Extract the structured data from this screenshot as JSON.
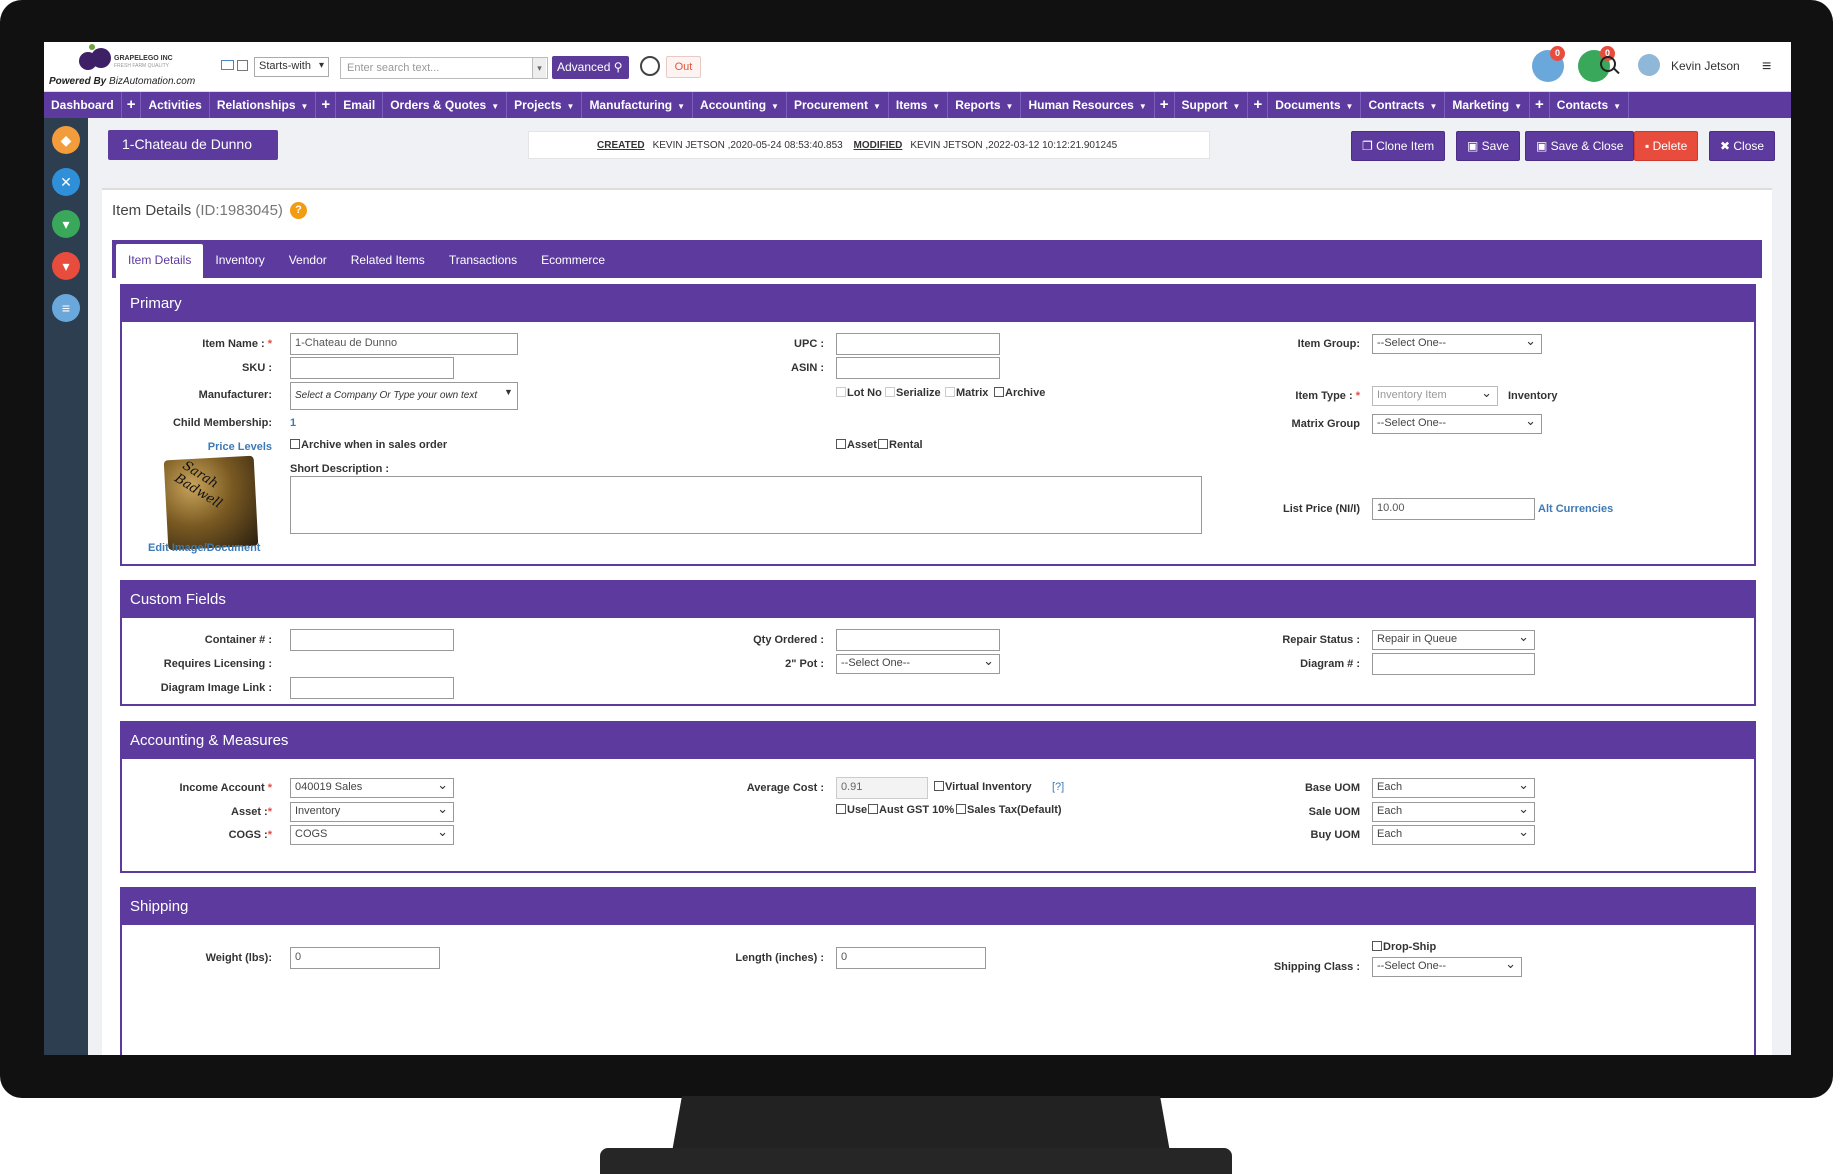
{
  "brand": {
    "company": "GRAPELEGO INC",
    "tagline": "FRESH FARM QUALITY",
    "powered_prefix": "Powered By",
    "powered_site": "BizAutomation.com"
  },
  "search": {
    "mode": "Starts-with",
    "placeholder": "Enter search text...",
    "advanced_label": "Advanced",
    "out_label": "Out"
  },
  "header": {
    "badge_orders": "0",
    "badge_cart": "0",
    "user_name": "Kevin Jetson"
  },
  "nav": {
    "items": [
      {
        "label": "Dashboard"
      },
      {
        "label": "Activities"
      },
      {
        "label": "Relationships"
      },
      {
        "label": "Email"
      },
      {
        "label": "Orders & Quotes"
      },
      {
        "label": "Projects"
      },
      {
        "label": "Manufacturing"
      },
      {
        "label": "Accounting"
      },
      {
        "label": "Procurement"
      },
      {
        "label": "Items"
      },
      {
        "label": "Reports"
      },
      {
        "label": "Human Resources"
      },
      {
        "label": "Support"
      },
      {
        "label": "Documents"
      },
      {
        "label": "Contracts"
      },
      {
        "label": "Marketing"
      },
      {
        "label": "Contacts"
      }
    ]
  },
  "record": {
    "title": "1-Chateau de Dunno",
    "created_label": "CREATED",
    "created_value": "KEVIN JETSON ,2020-05-24 08:53:40.853",
    "modified_label": "MODIFIED",
    "modified_value": "KEVIN JETSON ,2022-03-12 10:12:21.901245"
  },
  "actions": {
    "clone": "Clone Item",
    "save": "Save",
    "save_close": "Save & Close",
    "delete": "Delete",
    "close": "Close"
  },
  "card": {
    "title": "Item Details",
    "id_text": "(ID:1983045)",
    "help": "?"
  },
  "tabs": [
    "Item Details",
    "Inventory",
    "Vendor",
    "Related Items",
    "Transactions",
    "Ecommerce"
  ],
  "primary": {
    "heading": "Primary",
    "item_name_label": "Item Name :",
    "item_name_value": "1-Chateau de Dunno",
    "sku_label": "SKU :",
    "manufacturer_label": "Manufacturer:",
    "manufacturer_placeholder": "Select a Company Or Type your own text",
    "child_membership_label": "Child Membership:",
    "child_membership_value": "1",
    "price_levels": "Price Levels",
    "archive_sales_order": "Archive when in sales order",
    "short_description_label": "Short Description :",
    "edit_image": "Edit Image/Document",
    "upc_label": "UPC :",
    "asin_label": "ASIN :",
    "lot_no": "Lot No",
    "serialize": "Serialize",
    "matrix": "Matrix",
    "archive": "Archive",
    "asset": "Asset",
    "rental": "Rental",
    "item_group_label": "Item Group:",
    "item_group_value": "--Select One--",
    "item_type_label": "Item Type :",
    "item_type_value": "Inventory Item",
    "item_type_suffix": "Inventory",
    "matrix_group_label": "Matrix Group",
    "matrix_group_value": "--Select One--",
    "list_price_label": "List Price (NI/I)",
    "list_price_value": "10.00",
    "alt_currencies": "Alt Currencies"
  },
  "custom": {
    "heading": "Custom Fields",
    "container_label": "Container # :",
    "licensing_label": "Requires Licensing :",
    "diagram_link_label": "Diagram Image Link :",
    "qty_ordered_label": "Qty Ordered :",
    "pot_label": "2\" Pot :",
    "pot_value": "--Select One--",
    "repair_status_label": "Repair Status :",
    "repair_status_value": "Repair in Queue",
    "diagram_no_label": "Diagram # :"
  },
  "accounting": {
    "heading": "Accounting & Measures",
    "income_label": "Income Account",
    "income_value": "040019 Sales",
    "asset_label": "Asset :",
    "asset_value": "Inventory",
    "cogs_label": "COGS :",
    "cogs_value": "COGS",
    "avg_cost_label": "Average Cost :",
    "avg_cost_value": "0.91",
    "virtual_inventory": "Virtual Inventory",
    "virtual_help": "[?]",
    "use": "Use",
    "aust_gst": "Aust GST 10%",
    "sales_tax": "Sales Tax(Default)",
    "base_uom_label": "Base UOM",
    "base_uom_value": "Each",
    "sale_uom_label": "Sale UOM",
    "sale_uom_value": "Each",
    "buy_uom_label": "Buy UOM",
    "buy_uom_value": "Each"
  },
  "shipping": {
    "heading": "Shipping",
    "weight_label": "Weight (lbs):",
    "weight_value": "0",
    "length_label": "Length (inches) :",
    "length_value": "0",
    "drop_ship": "Drop-Ship",
    "shipping_class_label": "Shipping Class :",
    "shipping_class_value": "--Select One--"
  },
  "colors": {
    "brand_purple": "#5c3a9e",
    "danger": "#e84c3d",
    "link": "#3d7ab5",
    "rail": "#2c3e50"
  },
  "icons": {
    "rail": [
      "tag-icon",
      "tools-icon",
      "cart-icon",
      "cart-icon",
      "database-icon"
    ]
  }
}
